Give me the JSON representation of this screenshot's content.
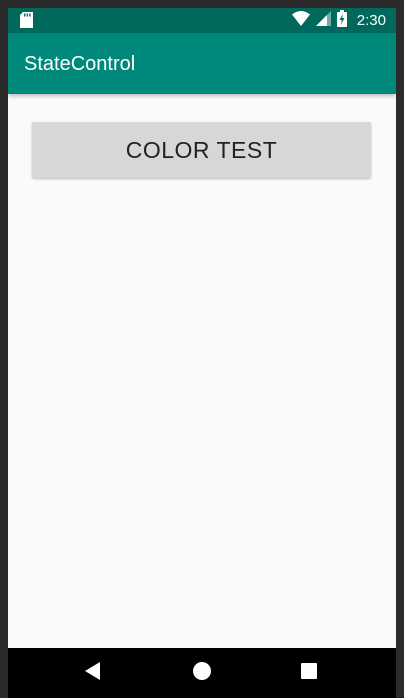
{
  "status_bar": {
    "time": "2:30",
    "icons": [
      "sd-card-icon",
      "wifi-icon",
      "cell-signal-icon",
      "battery-charging-icon"
    ]
  },
  "app_bar": {
    "title": "StateControl"
  },
  "main": {
    "color_test_button_label": "COLOR TEST"
  },
  "nav_bar": {
    "icons": [
      "back-icon",
      "home-icon",
      "recents-icon"
    ]
  },
  "colors": {
    "status_bar": "#00695c",
    "app_bar": "#00897b",
    "background": "#fafafa",
    "button": "#d6d7d7",
    "nav_bar": "#000000"
  }
}
